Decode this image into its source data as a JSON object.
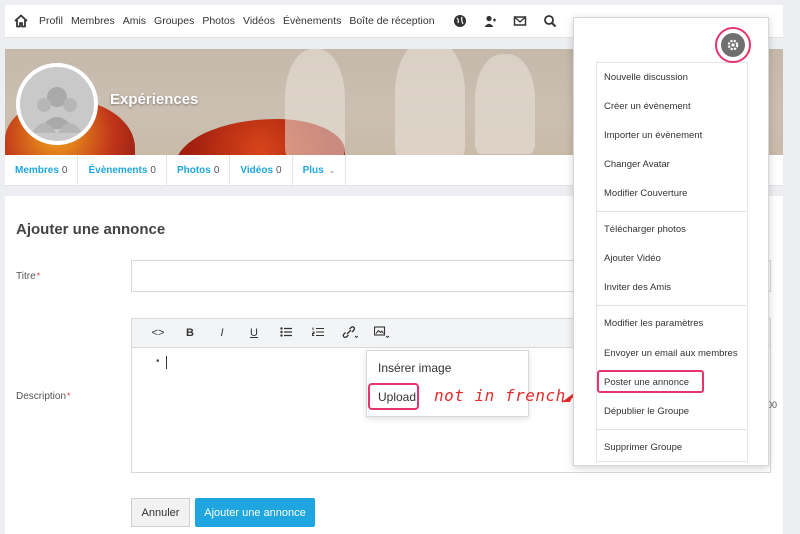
{
  "topnav": {
    "items": [
      "Profil",
      "Membres",
      "Amis",
      "Groupes",
      "Photos",
      "Vidéos",
      "Évènements",
      "Boîte de réception"
    ],
    "icons": [
      "home-icon",
      "globe-icon",
      "user-icon",
      "mail-icon",
      "search-icon"
    ]
  },
  "group": {
    "title": "Expériences"
  },
  "tabs": [
    {
      "label": "Membres",
      "count": "0"
    },
    {
      "label": "Évènements",
      "count": "0"
    },
    {
      "label": "Photos",
      "count": "0"
    },
    {
      "label": "Vidéos",
      "count": "0"
    },
    {
      "label": "Plus",
      "count": ""
    }
  ],
  "form": {
    "title": "Ajouter une annonce",
    "titre_label": "Titre",
    "description_label": "Description",
    "required_mark": "*",
    "cancel_label": "Annuler",
    "submit_label": "Ajouter une annonce"
  },
  "editor": {
    "toolbar": [
      "<>",
      "B",
      "I",
      "U",
      "ul",
      "ol",
      "link",
      "image"
    ],
    "image_menu": {
      "insert_label": "Insérer image",
      "upload_label": "Upload"
    }
  },
  "annotation": {
    "note": "not in french ?",
    "color": "#e32b2b"
  },
  "dropdown": {
    "items": [
      "Nouvelle discussion",
      "Créer un évènement",
      "Importer un évènement",
      "Changer Avatar",
      "Modifier Couverture",
      "Télécharger photos",
      "Ajouter Vidéo",
      "Inviter des Amis",
      "Modifier les paramètres",
      "Envoyer un email aux membres",
      "Poster une annonce",
      "Dépublier le Groupe",
      "Supprimer Groupe"
    ]
  },
  "colors": {
    "accent": "#1fa6e0",
    "highlight": "#e6356b"
  },
  "background_fragment": {
    "text": "00"
  }
}
